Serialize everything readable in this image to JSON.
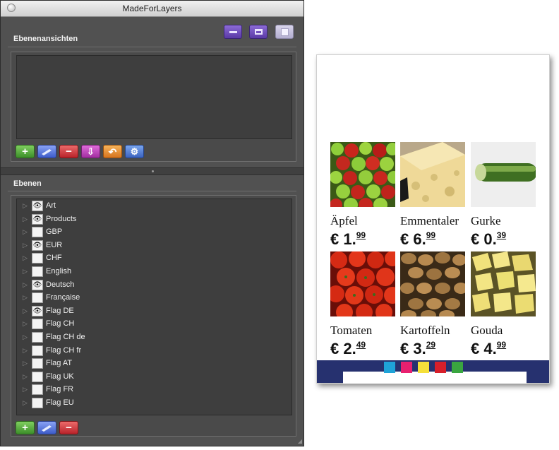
{
  "window": {
    "title": "MadeForLayers"
  },
  "views_section": {
    "label": "Ebenenansichten"
  },
  "layers_section": {
    "label": "Ebenen"
  },
  "top_buttons": [
    {
      "icon": "minimize-icon",
      "enabled": true
    },
    {
      "icon": "window-icon",
      "enabled": true
    },
    {
      "icon": "save-icon",
      "enabled": false
    }
  ],
  "view_toolbar": [
    {
      "icon": "add-icon",
      "glyph": "+"
    },
    {
      "icon": "edit-icon",
      "glyph": ""
    },
    {
      "icon": "delete-icon",
      "glyph": "−"
    },
    {
      "icon": "merge-down-icon",
      "glyph": "⇩"
    },
    {
      "icon": "undo-icon",
      "glyph": "↶"
    },
    {
      "icon": "settings-gear-icon",
      "glyph": "⚙"
    }
  ],
  "layer_toolbar": [
    {
      "icon": "add-icon",
      "glyph": "+"
    },
    {
      "icon": "edit-icon",
      "glyph": ""
    },
    {
      "icon": "delete-icon",
      "glyph": "−"
    }
  ],
  "layers": [
    {
      "name": "Art",
      "visible": true
    },
    {
      "name": "Products",
      "visible": true
    },
    {
      "name": "GBP",
      "visible": false
    },
    {
      "name": "EUR",
      "visible": true
    },
    {
      "name": "CHF",
      "visible": false
    },
    {
      "name": "English",
      "visible": false
    },
    {
      "name": "Deutsch",
      "visible": true
    },
    {
      "name": "Française",
      "visible": false
    },
    {
      "name": "Flag DE",
      "visible": true
    },
    {
      "name": "Flag CH",
      "visible": false
    },
    {
      "name": "Flag CH de",
      "visible": false
    },
    {
      "name": "Flag CH fr",
      "visible": false
    },
    {
      "name": "Flag AT",
      "visible": false
    },
    {
      "name": "Flag UK",
      "visible": false
    },
    {
      "name": "Flag FR",
      "visible": false
    },
    {
      "name": "Flag EU",
      "visible": false
    }
  ],
  "products": [
    {
      "name": "Äpfel",
      "currency": "€",
      "whole": "1.",
      "cents": "99",
      "image": "apples-photo"
    },
    {
      "name": "Emmentaler",
      "currency": "€",
      "whole": "6.",
      "cents": "99",
      "image": "emmental-cheese-photo"
    },
    {
      "name": "Gurke",
      "currency": "€",
      "whole": "0.",
      "cents": "39",
      "image": "cucumber-photo"
    },
    {
      "name": "Tomaten",
      "currency": "€",
      "whole": "2.",
      "cents": "49",
      "image": "tomatoes-photo"
    },
    {
      "name": "Kartoffeln",
      "currency": "€",
      "whole": "3.",
      "cents": "29",
      "image": "potatoes-photo"
    },
    {
      "name": "Gouda",
      "currency": "€",
      "whole": "4.",
      "cents": "99",
      "image": "gouda-cheese-photo"
    }
  ],
  "colors": {
    "panel_bg": "#515151",
    "footer_band": "#26316f",
    "swatches": [
      "#1fa3d8",
      "#e8206f",
      "#f5e03a",
      "#d71f2a",
      "#3aa640"
    ]
  }
}
